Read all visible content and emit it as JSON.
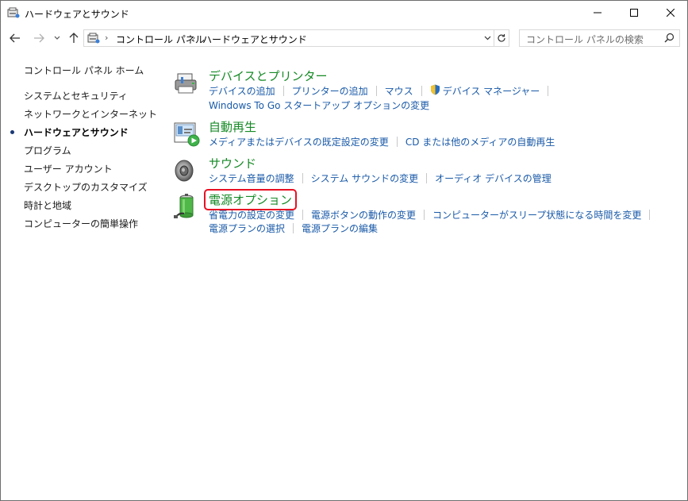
{
  "window": {
    "title": "ハードウェアとサウンド",
    "icon": "control-panel-icon",
    "controls": [
      "minimize-icon",
      "maximize-icon",
      "close-icon"
    ]
  },
  "navigation": {
    "back_icon": "arrow-left-icon",
    "forward_icon": "arrow-right-icon",
    "recent_icon": "chevron-down-icon",
    "up_icon": "arrow-up-icon",
    "address": {
      "segments": [
        "コントロール パネル",
        "ハードウェアとサウンド"
      ],
      "separator": "›"
    },
    "refresh_icon": "refresh-icon",
    "search": {
      "placeholder": "コントロール パネルの検索"
    }
  },
  "sidebar": {
    "items": [
      {
        "label": "コントロール パネル ホーム",
        "current": false
      },
      {
        "label": "システムとセキュリティ",
        "current": false
      },
      {
        "label": "ネットワークとインターネット",
        "current": false
      },
      {
        "label": "ハードウェアとサウンド",
        "current": true
      },
      {
        "label": "プログラム",
        "current": false
      },
      {
        "label": "ユーザー アカウント",
        "current": false
      },
      {
        "label": "デスクトップのカスタマイズ",
        "current": false
      },
      {
        "label": "時計と地域",
        "current": false
      },
      {
        "label": "コンピューターの簡単操作",
        "current": false
      }
    ]
  },
  "categories": [
    {
      "title": "デバイスとプリンター",
      "icon": "printer-icon",
      "rows": [
        [
          "デバイスの追加",
          "プリンターの追加",
          "マウス",
          "デバイス マネージャー"
        ],
        [
          "Windows To Go スタートアップ オプションの変更"
        ]
      ]
    },
    {
      "title": "自動再生",
      "icon": "autoplay-icon",
      "rows": [
        [
          "メディアまたはデバイスの既定設定の変更",
          "CD または他のメディアの自動再生"
        ]
      ]
    },
    {
      "title": "サウンド",
      "icon": "speaker-icon",
      "rows": [
        [
          "システム音量の調整",
          "システム サウンドの変更",
          "オーディオ デバイスの管理"
        ]
      ]
    },
    {
      "title": "電源オプション",
      "icon": "battery-power-icon",
      "highlighted": true,
      "rows": [
        [
          "省電力の設定の変更",
          "電源ボタンの動作の変更",
          "コンピューターがスリープ状態になる時間を変更"
        ],
        [
          "電源プランの選択",
          "電源プランの編集"
        ]
      ]
    }
  ],
  "colors": {
    "category_title": "#168a26",
    "link": "#1a5aa8",
    "highlight": "#e81123"
  }
}
